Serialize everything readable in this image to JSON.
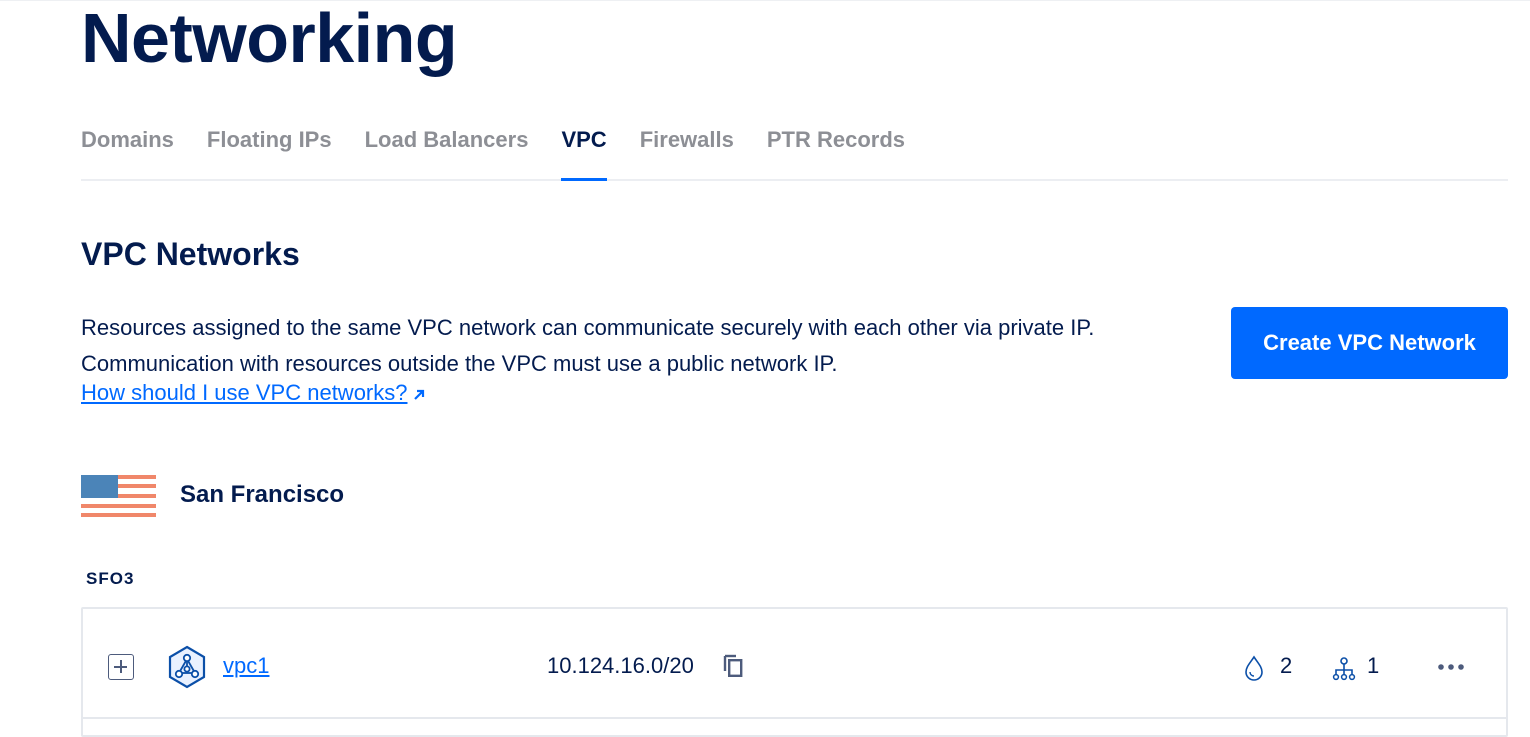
{
  "page": {
    "title": "Networking"
  },
  "tabs": [
    {
      "label": "Domains",
      "active": false
    },
    {
      "label": "Floating IPs",
      "active": false
    },
    {
      "label": "Load Balancers",
      "active": false
    },
    {
      "label": "VPC",
      "active": true
    },
    {
      "label": "Firewalls",
      "active": false
    },
    {
      "label": "PTR Records",
      "active": false
    }
  ],
  "section": {
    "title": "VPC Networks",
    "description_line1": "Resources assigned to the same VPC network can communicate securely with each other via private IP.",
    "description_line2": "Communication with resources outside the VPC must use a public network IP.",
    "help_link": "How should I use VPC networks?",
    "create_button": "Create VPC Network"
  },
  "region": {
    "name": "San Francisco",
    "flag_icon": "us-flag-icon",
    "datacenter": "SFO3"
  },
  "vpcs": [
    {
      "name": "vpc1",
      "ip_range": "10.124.16.0/20",
      "droplets": "2",
      "load_balancers": "1"
    }
  ],
  "colors": {
    "accent": "#0069ff",
    "text": "#031b4e",
    "muted": "#8d8f95",
    "flag_blue": "#4b84b8",
    "flag_red": "#f0876a"
  }
}
